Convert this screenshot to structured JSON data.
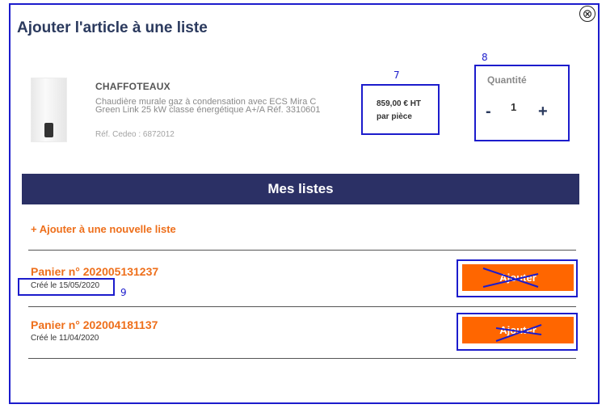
{
  "modal": {
    "title": "Ajouter l'article à une liste",
    "close_icon": "⊗"
  },
  "product": {
    "brand": "CHAFFOTEAUX",
    "description": "Chaudière murale gaz à condensation avec ECS Mira C Green Link 25 kW classe énergétique A+/A Réf. 3310601",
    "ref_cedeo": "Réf. Cedeo : 6872012",
    "price": "859,00 € HT",
    "price_unit": "par pièce"
  },
  "quantity": {
    "label": "Quantité",
    "minus": "-",
    "value": "1",
    "plus": "+"
  },
  "lists": {
    "header": "Mes listes",
    "add_new": "+ Ajouter à une nouvelle liste",
    "items": [
      {
        "name": "Panier n° 202005131237",
        "date": "Créé le 15/05/2020",
        "button": "Ajouter"
      },
      {
        "name": "Panier n° 202004181137",
        "date": "Créé le 11/04/2020",
        "button": "Ajouter"
      }
    ]
  },
  "annotations": {
    "price_box": "7",
    "quantity_box": "8",
    "date_box": "9"
  },
  "colors": {
    "annotation": "#1c1ccc",
    "accent": "#ee6f1b",
    "button": "#ff6600",
    "header_bg": "#2b3065"
  }
}
